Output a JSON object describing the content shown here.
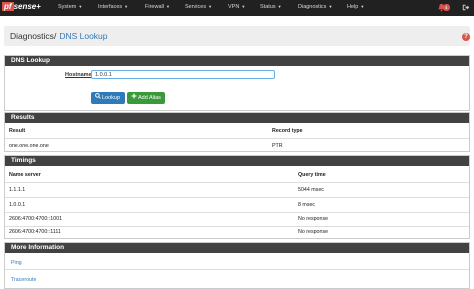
{
  "brand": {
    "pf": "pf",
    "sense": "sense",
    "plus": "+"
  },
  "nav": [
    {
      "label": "System"
    },
    {
      "label": "Interfaces"
    },
    {
      "label": "Firewall"
    },
    {
      "label": "Services"
    },
    {
      "label": "VPN"
    },
    {
      "label": "Status"
    },
    {
      "label": "Diagnostics"
    },
    {
      "label": "Help"
    }
  ],
  "notifications": {
    "count": "4"
  },
  "breadcrumb": {
    "section": "Diagnostics",
    "separator": "/",
    "page": "DNS Lookup"
  },
  "help_icon": "?",
  "lookup_panel": {
    "title": "DNS Lookup",
    "hostname_label": "Hostname",
    "hostname_value": "1.0.0.1",
    "lookup_button": "Lookup",
    "add_alias_button": "Add Alias"
  },
  "results": {
    "title": "Results",
    "columns": [
      "Result",
      "Record type"
    ],
    "rows": [
      [
        "one.one.one.one",
        "PTR"
      ]
    ]
  },
  "timings": {
    "title": "Timings",
    "columns": [
      "Name server",
      "Query time"
    ],
    "rows": [
      [
        "1.1.1.1",
        "5044 msec"
      ],
      [
        "1.0.0.1",
        "8 msec"
      ],
      [
        "2606:4700:4700::1001",
        "No response"
      ],
      [
        "2606:4700:4700::1111",
        "No response"
      ]
    ]
  },
  "more_info": {
    "title": "More Information",
    "links": [
      "Ping",
      "Traceroute"
    ]
  },
  "icons": {
    "bell": "bell-icon",
    "logout": "logout-icon",
    "search": "search-icon",
    "plus": "plus-icon"
  },
  "colors": {
    "navbar": "#212121",
    "panel_head": "#424242",
    "link": "#337ab7",
    "danger": "#d9534f",
    "primary": "#2f7ab8",
    "success": "#3a9a3a"
  }
}
